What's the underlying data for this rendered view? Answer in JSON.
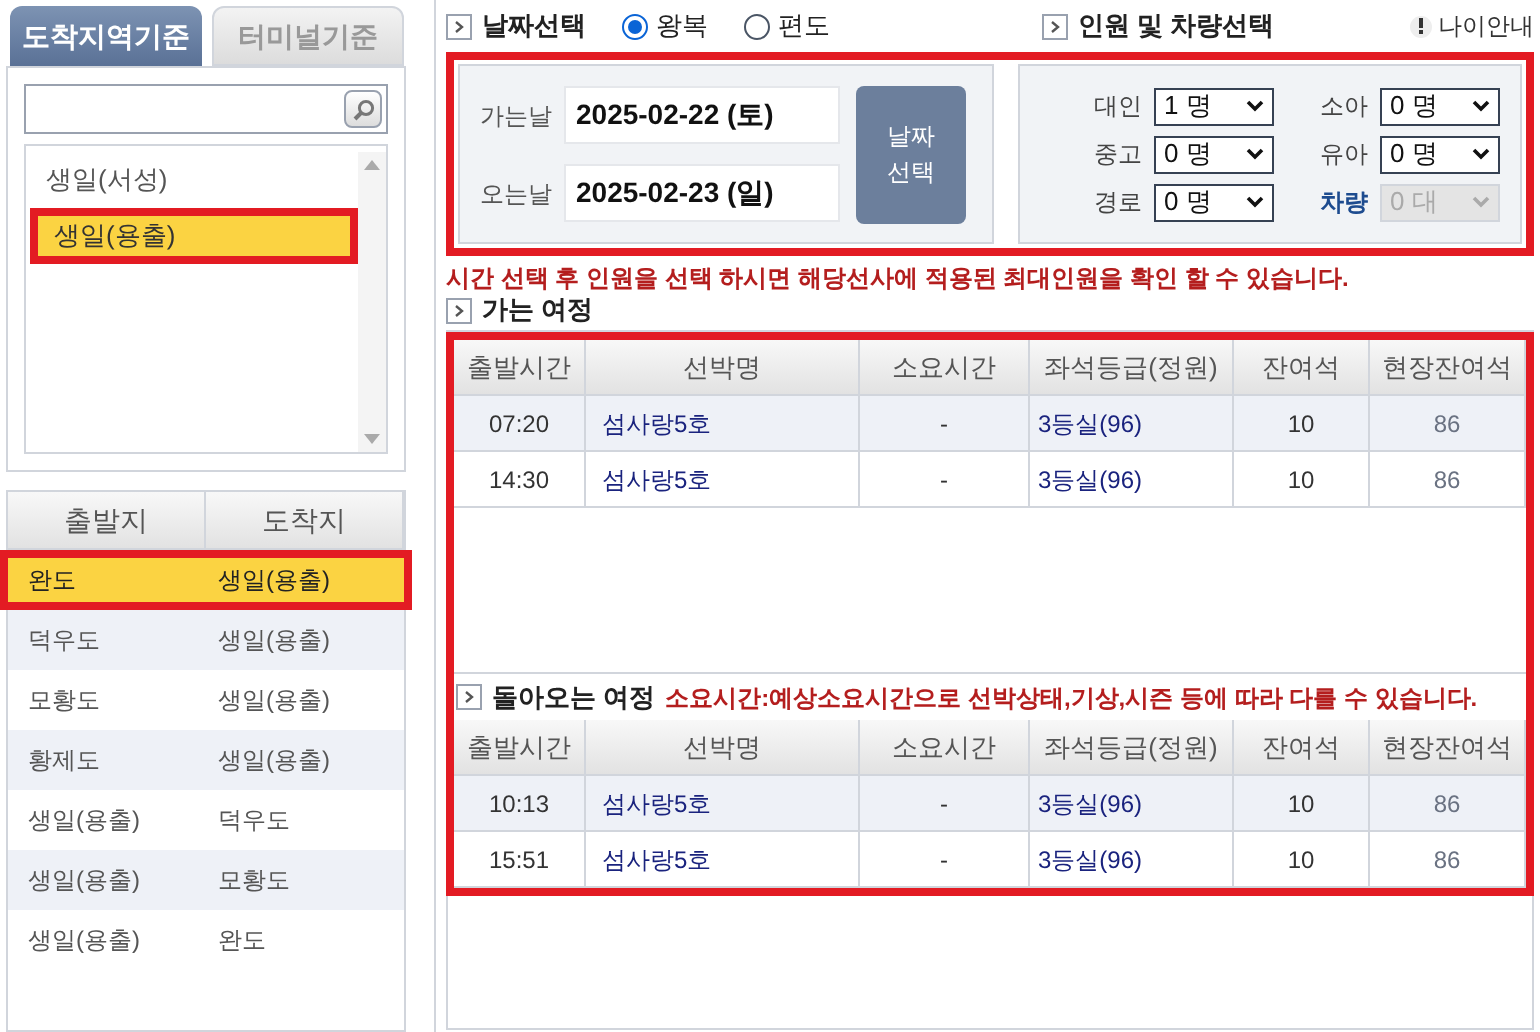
{
  "left_tabs": [
    {
      "label": "도착지역기준",
      "selected": true
    },
    {
      "label": "터미널기준",
      "selected": false
    }
  ],
  "region_list": [
    {
      "label": "생일(서성)",
      "selected": false
    },
    {
      "label": "생일(용출)",
      "selected": true
    }
  ],
  "routes": {
    "columns": [
      "출발지",
      "도착지"
    ],
    "rows": [
      {
        "cells": [
          "완도",
          "생일(용출)"
        ],
        "selected": true
      },
      {
        "cells": [
          "덕우도",
          "생일(용출)"
        ],
        "selected": false
      },
      {
        "cells": [
          "모황도",
          "생일(용출)"
        ],
        "selected": false
      },
      {
        "cells": [
          "황제도",
          "생일(용출)"
        ],
        "selected": false
      },
      {
        "cells": [
          "생일(용출)",
          "덕우도"
        ],
        "selected": false
      },
      {
        "cells": [
          "생일(용출)",
          "모황도"
        ],
        "selected": false
      },
      {
        "cells": [
          "생일(용출)",
          "완도"
        ],
        "selected": false
      }
    ]
  },
  "date_section": {
    "title": "날짜선택",
    "trip_types": [
      {
        "label": "왕복",
        "selected": true
      },
      {
        "label": "편도",
        "selected": false
      }
    ],
    "dates": [
      {
        "label": "가는날",
        "value": "2025-02-22 (토)"
      },
      {
        "label": "오는날",
        "value": "2025-02-23 (일)"
      }
    ],
    "button": "날짜 선택"
  },
  "passenger_section": {
    "title": "인원 및 차량선택",
    "age_guide": "나이안내",
    "fields": [
      {
        "label": "대인",
        "value": "1 명",
        "disabled": false
      },
      {
        "label": "소아",
        "value": "0 명",
        "disabled": false
      },
      {
        "label": "중고",
        "value": "0 명",
        "disabled": false
      },
      {
        "label": "유아",
        "value": "0 명",
        "disabled": false
      },
      {
        "label": "경로",
        "value": "0 명",
        "disabled": false
      },
      {
        "label": "차량",
        "value": "0 대",
        "disabled": true
      }
    ]
  },
  "notice": "시간 선택 후 인원을 선택 하시면 해당선사에 적용된 최대인원을 확인 할 수 있습니다.",
  "outbound": {
    "title": "가는 여정",
    "columns": [
      "출발시간",
      "선박명",
      "소요시간",
      "좌석등급(정원)",
      "잔여석",
      "현장잔여석"
    ],
    "rows": [
      {
        "cells": [
          "07:20",
          "섬사랑5호",
          "-",
          "3등실(96)",
          "10",
          "86"
        ]
      },
      {
        "cells": [
          "14:30",
          "섬사랑5호",
          "-",
          "3등실(96)",
          "10",
          "86"
        ]
      }
    ]
  },
  "return": {
    "title": "돌아오는 여정",
    "note": "소요시간:예상소요시간으로 선박상태,기상,시즌 등에 따라 다를 수 있습니다.",
    "columns": [
      "출발시간",
      "선박명",
      "소요시간",
      "좌석등급(정원)",
      "잔여석",
      "현장잔여석"
    ],
    "rows": [
      {
        "cells": [
          "10:13",
          "섬사랑5호",
          "-",
          "3등실(96)",
          "10",
          "86"
        ]
      },
      {
        "cells": [
          "15:51",
          "섬사랑5호",
          "-",
          "3등실(96)",
          "10",
          "86"
        ]
      }
    ]
  }
}
